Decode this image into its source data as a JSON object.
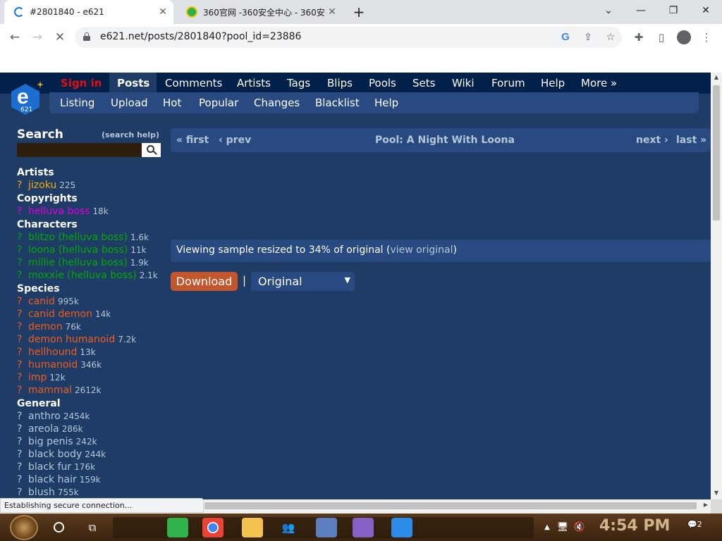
{
  "browser": {
    "tabs": [
      {
        "title": "#2801840 - e621",
        "active": true
      },
      {
        "title": "360官网 -360安全中心 - 360安",
        "active": false
      }
    ],
    "url": "e621.net/posts/2801840?pool_id=23886",
    "status": "Establishing secure connection..."
  },
  "site": {
    "nav": {
      "signin": "Sign in",
      "items": [
        "Posts",
        "Comments",
        "Artists",
        "Tags",
        "Blips",
        "Pools",
        "Sets",
        "Wiki",
        "Forum",
        "Help",
        "More »"
      ],
      "sub": [
        "Listing",
        "Upload",
        "Hot",
        "Popular",
        "Changes",
        "Blacklist",
        "Help"
      ],
      "logo_number": "621"
    },
    "search": {
      "title": "Search",
      "help": "(search help)"
    },
    "tags": {
      "artists_title": "Artists",
      "artists": [
        {
          "name": "jizoku",
          "count": "225"
        }
      ],
      "copyrights_title": "Copyrights",
      "copyrights": [
        {
          "name": "helluva boss",
          "count": "18k"
        }
      ],
      "characters_title": "Characters",
      "characters": [
        {
          "name": "blitzo (helluva boss)",
          "count": "1.6k"
        },
        {
          "name": "loona (helluva boss)",
          "count": "11k"
        },
        {
          "name": "millie (helluva boss)",
          "count": "1.9k"
        },
        {
          "name": "moxxie (helluva boss)",
          "count": "2.1k"
        }
      ],
      "species_title": "Species",
      "species": [
        {
          "name": "canid",
          "count": "995k"
        },
        {
          "name": "canid demon",
          "count": "14k"
        },
        {
          "name": "demon",
          "count": "76k"
        },
        {
          "name": "demon humanoid",
          "count": "7.2k"
        },
        {
          "name": "hellhound",
          "count": "13k"
        },
        {
          "name": "humanoid",
          "count": "346k"
        },
        {
          "name": "imp",
          "count": "12k"
        },
        {
          "name": "mammal",
          "count": "2612k"
        }
      ],
      "general_title": "General",
      "general": [
        {
          "name": "anthro",
          "count": "2454k"
        },
        {
          "name": "areola",
          "count": "286k"
        },
        {
          "name": "big penis",
          "count": "242k"
        },
        {
          "name": "black body",
          "count": "244k"
        },
        {
          "name": "black fur",
          "count": "176k"
        },
        {
          "name": "black hair",
          "count": "159k"
        },
        {
          "name": "blush",
          "count": "755k"
        }
      ],
      "question": "?"
    },
    "pool": {
      "first": "« first",
      "prev": "‹ prev",
      "title": "Pool: A Night With Loona",
      "next": "next ›",
      "last": "last »"
    },
    "notice": {
      "prefix": "Viewing sample resized to 34% of original (",
      "link": "view original",
      "suffix": ")"
    },
    "download": {
      "label": "Download",
      "pipe": "|",
      "select_value": "Original"
    }
  },
  "taskbar": {
    "time": "4:54 PM",
    "notifications": "2"
  },
  "colors": {
    "bg": "#1f3c67",
    "nav": "#01214b",
    "section": "#284a81",
    "artist": "#f2ac08",
    "copyright": "#dd00dd",
    "character": "#00aa00",
    "species": "#ed5d1f",
    "general": "#b4c7d9",
    "download": "#c3562c"
  }
}
